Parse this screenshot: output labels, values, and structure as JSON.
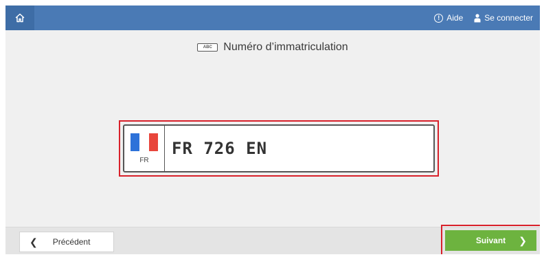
{
  "header": {
    "help_label": "Aide",
    "login_label": "Se connecter",
    "background_color": "#4a7ab5",
    "home_icon": "home-icon",
    "help_icon": "help-circle-icon",
    "user_icon": "user-icon"
  },
  "main": {
    "title": "Numéro d’immatriculation",
    "title_icon": "license-plate-icon",
    "title_icon_text": "ABC",
    "plate": {
      "country_code": "FR",
      "value": "FR 726 EN",
      "flag_colors": [
        "#2d72d9",
        "#ffffff",
        "#e8453b"
      ]
    }
  },
  "footer": {
    "previous_label": "Précédent",
    "next_label": "Suivant",
    "next_color": "#6db33f",
    "highlight_color": "#d8202a"
  }
}
